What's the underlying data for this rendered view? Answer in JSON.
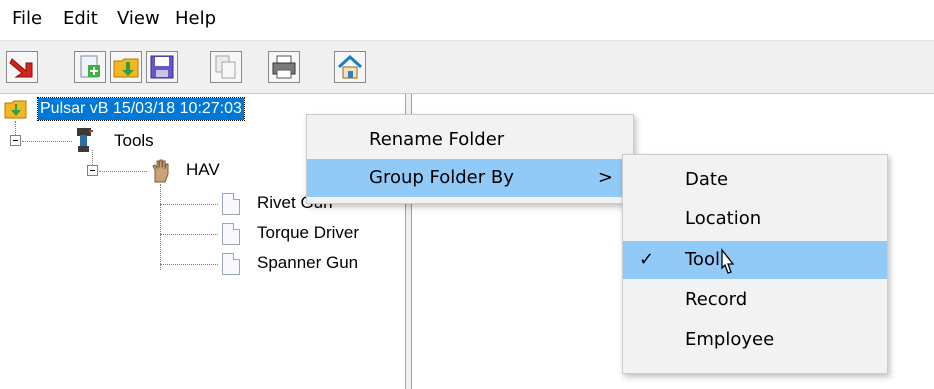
{
  "menubar": {
    "items": [
      "File",
      "Edit",
      "View",
      "Help"
    ]
  },
  "toolbar": {
    "buttons": [
      {
        "name": "exit-icon"
      },
      {
        "name": "new-document-icon"
      },
      {
        "name": "open-folder-icon"
      },
      {
        "name": "save-icon"
      },
      {
        "name": "copy-icon"
      },
      {
        "name": "print-icon"
      },
      {
        "name": "home-icon"
      }
    ]
  },
  "tree": {
    "root": "Pulsar vB 15/03/18 10:27:03",
    "tools": "Tools",
    "hav": "HAV",
    "items": [
      "Rivet Gun",
      "Torque Driver",
      "Spanner Gun"
    ]
  },
  "context_menu": {
    "items": [
      {
        "label": "Rename Folder"
      },
      {
        "label": "Group Folder By",
        "arrow": ">"
      }
    ]
  },
  "submenu": {
    "items": [
      {
        "label": "Date"
      },
      {
        "label": "Location"
      },
      {
        "label": "Tool",
        "checked": true,
        "check": "✓"
      },
      {
        "label": "Record"
      },
      {
        "label": "Employee"
      }
    ]
  },
  "colors": {
    "selection": "#0078d7",
    "menu_highlight": "#91c9f7",
    "menu_bg": "#f2f2f2"
  }
}
